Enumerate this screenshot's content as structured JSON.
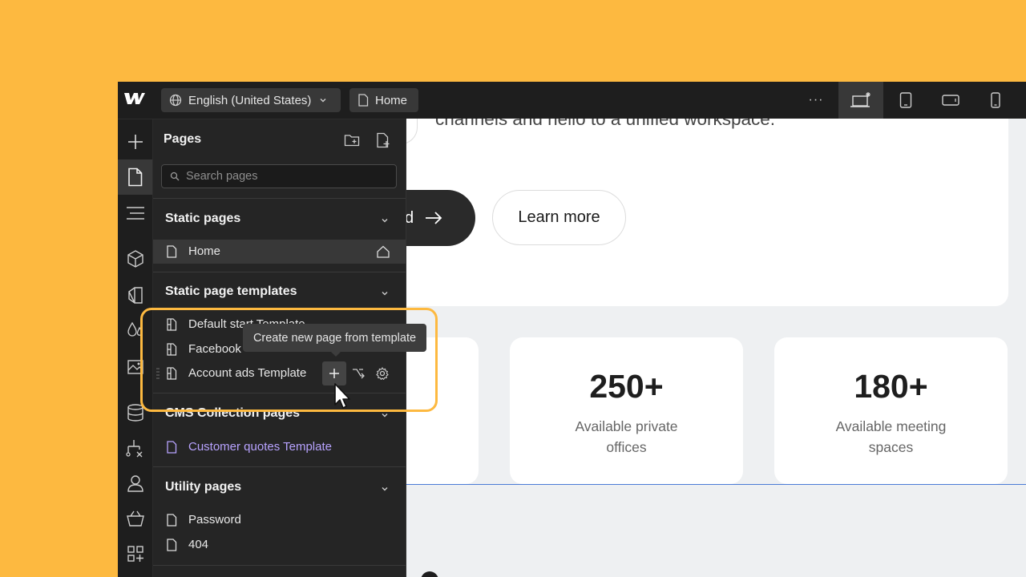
{
  "topbar": {
    "locale_label": "English (United States)",
    "page_label": "Home",
    "more_label": "···"
  },
  "pages_panel": {
    "title": "Pages",
    "search_placeholder": "Search pages",
    "sections": {
      "static": {
        "title": "Static pages",
        "items": [
          "Home"
        ]
      },
      "templates": {
        "title": "Static page templates",
        "items": [
          "Default start Template",
          "Facebook",
          "Account ads Template"
        ]
      },
      "cms": {
        "title": "CMS Collection pages",
        "items": [
          "Customer quotes Template"
        ]
      },
      "utility": {
        "title": "Utility pages",
        "items": [
          "Password",
          "404"
        ]
      }
    },
    "tooltip": "Create new page from template"
  },
  "canvas": {
    "hero_text": "channels and hello to a unified workspace.",
    "cta_partial": "d",
    "learn_more": "Learn more",
    "stats": [
      {
        "value": "250+",
        "caption_line1": "Available private",
        "caption_line2": "offices"
      },
      {
        "value": "180+",
        "caption_line1": "Available meeting",
        "caption_line2": "spaces"
      }
    ]
  },
  "colors": {
    "background": "#FDB940",
    "highlight": "#FDB940",
    "cms_accent": "#B8A3FF",
    "selection_line": "#4B7BD6"
  },
  "icons": [
    "webflow-logo-icon",
    "globe-icon",
    "chevron-down-icon",
    "page-icon",
    "more-icon",
    "desktop-star-icon",
    "tablet-icon",
    "tablet-landscape-icon",
    "phone-icon",
    "add-icon",
    "pages-icon",
    "navigator-icon",
    "components-icon",
    "style-selector-icon",
    "variables-icon",
    "assets-icon",
    "cms-icon",
    "logic-icon",
    "users-icon",
    "ecommerce-icon",
    "apps-icon",
    "new-folder-icon",
    "new-page-icon",
    "search-icon",
    "home-icon",
    "template-icon",
    "settings-icon",
    "arrow-right-icon",
    "cursor-icon"
  ]
}
